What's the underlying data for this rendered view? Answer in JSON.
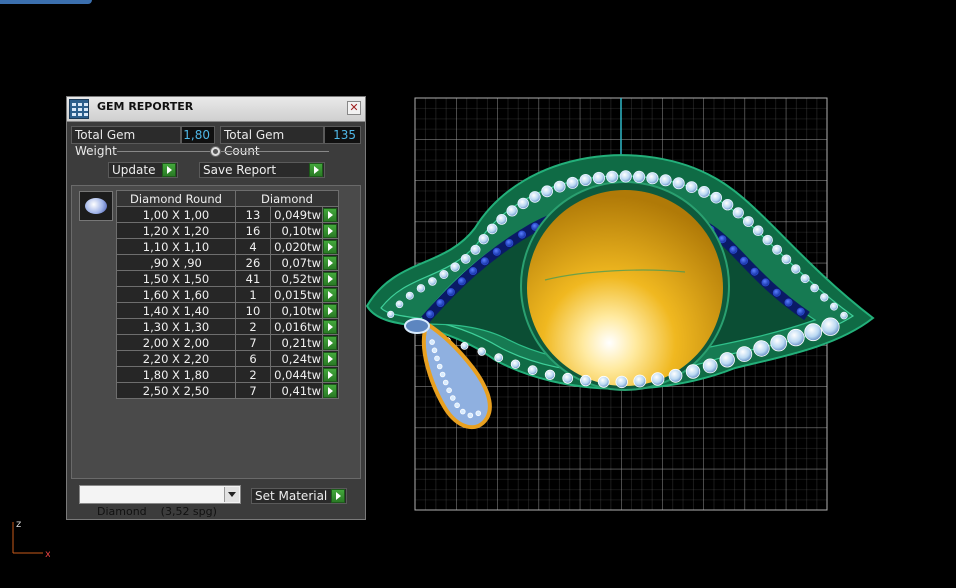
{
  "panel": {
    "title": "GEM REPORTER",
    "close_glyph": "✕",
    "total_weight_label": "Total Gem Weight",
    "total_weight_value": "1,80",
    "total_count_label": "Total Gem Count",
    "total_count_value": "135",
    "update_label": "Update",
    "save_report_label": "Save Report",
    "table_header_size": "Diamond Round",
    "table_header_material": "Diamond",
    "rows": [
      {
        "size": "1,00 X 1,00",
        "count": "13",
        "weight": "0,049tw"
      },
      {
        "size": "1,20 X 1,20",
        "count": "16",
        "weight": "0,10tw"
      },
      {
        "size": "1,10 X 1,10",
        "count": "4",
        "weight": "0,020tw"
      },
      {
        "size": ",90 X ,90",
        "count": "26",
        "weight": "0,07tw"
      },
      {
        "size": "1,50 X 1,50",
        "count": "41",
        "weight": "0,52tw"
      },
      {
        "size": "1,60 X 1,60",
        "count": "1",
        "weight": "0,015tw"
      },
      {
        "size": "1,40 X 1,40",
        "count": "10",
        "weight": "0,10tw"
      },
      {
        "size": "1,30 X 1,30",
        "count": "2",
        "weight": "0,016tw"
      },
      {
        "size": "2,00 X 2,00",
        "count": "7",
        "weight": "0,21tw"
      },
      {
        "size": "2,20 X 2,20",
        "count": "6",
        "weight": "0,24tw"
      },
      {
        "size": "1,80 X 1,80",
        "count": "2",
        "weight": "0,044tw"
      },
      {
        "size": "2,50 X 2,50",
        "count": "7",
        "weight": "0,41tw"
      }
    ],
    "material_select_value": "Diamond    (3,52 spg)",
    "set_material_label": "Set Material"
  },
  "axes": {
    "z_label": "z",
    "x_label": "x"
  },
  "colors": {
    "accent_value": "#4fb8e8",
    "button_green": "#3a9a34",
    "metal_green": "#1f8f5e",
    "gold": "#e8b020",
    "grid": "#9a9a9a"
  }
}
